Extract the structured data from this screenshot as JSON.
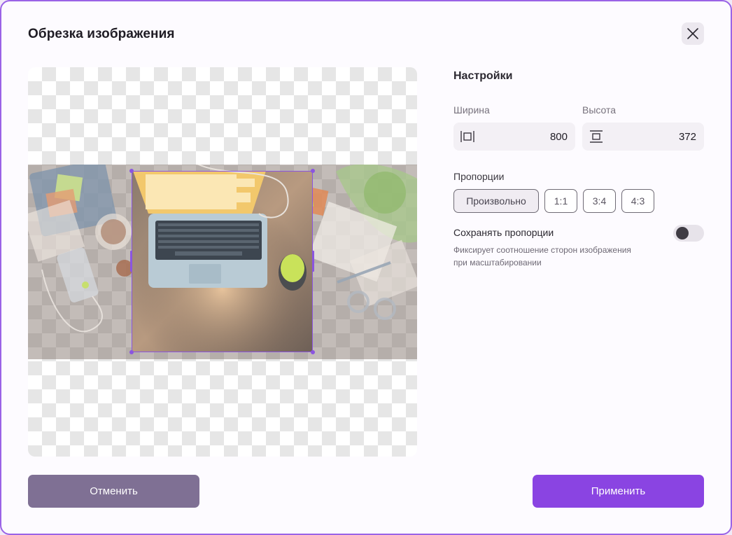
{
  "dialog": {
    "title": "Обрезка изображения",
    "close_icon": "close-icon"
  },
  "settings": {
    "title": "Настройки",
    "width": {
      "label": "Ширина",
      "value": "800",
      "icon": "width-icon"
    },
    "height": {
      "label": "Высота",
      "value": "372",
      "icon": "height-icon"
    },
    "proportions": {
      "label": "Пропорции",
      "options": [
        "Произвольно",
        "1:1",
        "3:4",
        "4:3"
      ],
      "selected": "Произвольно"
    },
    "keep_proportions": {
      "label": "Сохранять пропорции",
      "hint_line1": "Фиксирует соотношение сторон изображения",
      "hint_line2": "при масштабировании",
      "enabled": false
    }
  },
  "actions": {
    "cancel": "Отменить",
    "apply": "Применить"
  },
  "colors": {
    "accent": "#8a44e2",
    "cancel": "#7f7094",
    "frame": "#9a63e6"
  }
}
